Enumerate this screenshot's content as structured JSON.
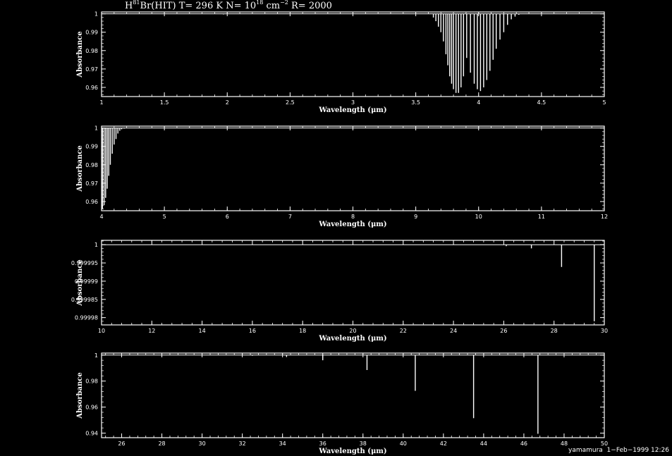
{
  "title": {
    "species_prefix": "H",
    "isotope": "81",
    "species_rest": "Br(HIT) T= 296 K N= 10",
    "exponent_n": "18",
    "unit": " cm",
    "exponent_unit": "−2",
    "resolution": " R= 2000"
  },
  "footer": "yamamura  1−Feb−1999 12:26",
  "chart_data": [
    {
      "type": "line",
      "xlabel": "Wavelength (μm)",
      "ylabel": "Absorbance",
      "xlim": [
        1,
        5
      ],
      "ylim": [
        0.955,
        1.001
      ],
      "xticks": [
        1,
        1.5,
        2,
        2.5,
        3,
        3.5,
        4,
        4.5,
        5
      ],
      "xtick_labels": [
        "1",
        "1.5",
        "2",
        "2.5",
        "3",
        "3.5",
        "4",
        "4.5",
        "5"
      ],
      "yticks": [
        0.96,
        0.97,
        0.98,
        0.99,
        1
      ],
      "ytick_labels": [
        "0.96",
        "0.97",
        "0.98",
        "0.99",
        "1"
      ],
      "lines": [
        {
          "x": 1.97,
          "y": 0.9997
        },
        {
          "x": 3.64,
          "y": 0.998
        },
        {
          "x": 3.66,
          "y": 0.996
        },
        {
          "x": 3.68,
          "y": 0.993
        },
        {
          "x": 3.7,
          "y": 0.99
        },
        {
          "x": 3.72,
          "y": 0.985
        },
        {
          "x": 3.74,
          "y": 0.978
        },
        {
          "x": 3.755,
          "y": 0.972
        },
        {
          "x": 3.77,
          "y": 0.966
        },
        {
          "x": 3.785,
          "y": 0.962
        },
        {
          "x": 3.8,
          "y": 0.959
        },
        {
          "x": 3.82,
          "y": 0.957
        },
        {
          "x": 3.84,
          "y": 0.957
        },
        {
          "x": 3.86,
          "y": 0.96
        },
        {
          "x": 3.88,
          "y": 0.966
        },
        {
          "x": 3.905,
          "y": 0.976
        },
        {
          "x": 3.935,
          "y": 0.968
        },
        {
          "x": 3.965,
          "y": 0.962
        },
        {
          "x": 3.99,
          "y": 0.959
        },
        {
          "x": 4.015,
          "y": 0.958
        },
        {
          "x": 4.04,
          "y": 0.96
        },
        {
          "x": 4.065,
          "y": 0.964
        },
        {
          "x": 4.09,
          "y": 0.969
        },
        {
          "x": 4.115,
          "y": 0.975
        },
        {
          "x": 4.14,
          "y": 0.981
        },
        {
          "x": 4.17,
          "y": 0.986
        },
        {
          "x": 4.2,
          "y": 0.99
        },
        {
          "x": 4.23,
          "y": 0.994
        },
        {
          "x": 4.26,
          "y": 0.997
        },
        {
          "x": 4.29,
          "y": 0.9985
        },
        {
          "x": 4.32,
          "y": 0.9995
        }
      ]
    },
    {
      "type": "line",
      "xlabel": "Wavelength (μm)",
      "ylabel": "Absorbance",
      "xlim": [
        4,
        12
      ],
      "ylim": [
        0.955,
        1.001
      ],
      "xticks": [
        4,
        5,
        6,
        7,
        8,
        9,
        10,
        11,
        12
      ],
      "xtick_labels": [
        "4",
        "5",
        "6",
        "7",
        "8",
        "9",
        "10",
        "11",
        "12"
      ],
      "yticks": [
        0.96,
        0.97,
        0.98,
        0.99,
        1
      ],
      "ytick_labels": [
        "0.96",
        "0.97",
        "0.98",
        "0.99",
        "1"
      ],
      "lines": [
        {
          "x": 4.015,
          "y": 0.956
        },
        {
          "x": 4.04,
          "y": 0.958
        },
        {
          "x": 4.065,
          "y": 0.962
        },
        {
          "x": 4.09,
          "y": 0.967
        },
        {
          "x": 4.115,
          "y": 0.974
        },
        {
          "x": 4.14,
          "y": 0.98
        },
        {
          "x": 4.17,
          "y": 0.986
        },
        {
          "x": 4.2,
          "y": 0.991
        },
        {
          "x": 4.23,
          "y": 0.994
        },
        {
          "x": 4.26,
          "y": 0.997
        },
        {
          "x": 4.29,
          "y": 0.9985
        },
        {
          "x": 4.32,
          "y": 0.9993
        },
        {
          "x": 4.36,
          "y": 0.9997
        },
        {
          "x": 4.4,
          "y": 0.9999
        }
      ]
    },
    {
      "type": "line",
      "xlabel": "Wavelength (μm)",
      "ylabel": "Absorbance",
      "xlim": [
        10,
        30
      ],
      "ylim": [
        0.999978,
        1.0000012
      ],
      "xticks": [
        10,
        12,
        14,
        16,
        18,
        20,
        22,
        24,
        26,
        28,
        30
      ],
      "xtick_labels": [
        "10",
        "12",
        "14",
        "16",
        "18",
        "20",
        "22",
        "24",
        "26",
        "28",
        "30"
      ],
      "yticks": [
        0.99998,
        0.999985,
        0.99999,
        0.999995,
        1
      ],
      "ytick_labels": [
        "0.99998",
        "0.999985",
        "0.99999",
        "0.999995",
        "1"
      ],
      "lines": [
        {
          "x": 26.1,
          "y": 0.9999996
        },
        {
          "x": 27.1,
          "y": 0.999999
        },
        {
          "x": 28.3,
          "y": 0.9999939
        },
        {
          "x": 29.6,
          "y": 0.999979
        }
      ]
    },
    {
      "type": "line",
      "xlabel": "Wavelength (μm)",
      "ylabel": "Absorbance",
      "xlim": [
        25,
        50
      ],
      "ylim": [
        0.9365,
        1.0015
      ],
      "xticks": [
        26,
        28,
        30,
        32,
        34,
        36,
        38,
        40,
        42,
        44,
        46,
        48,
        50
      ],
      "xtick_labels": [
        "26",
        "28",
        "30",
        "32",
        "34",
        "36",
        "38",
        "40",
        "42",
        "44",
        "46",
        "48",
        "50"
      ],
      "yticks": [
        0.94,
        0.96,
        0.98,
        1
      ],
      "ytick_labels": [
        "0.94",
        "0.96",
        "0.98",
        "1"
      ],
      "lines": [
        {
          "x": 32.5,
          "y": 0.9995
        },
        {
          "x": 34.2,
          "y": 0.9985
        },
        {
          "x": 36.0,
          "y": 0.996
        },
        {
          "x": 38.2,
          "y": 0.9885
        },
        {
          "x": 40.6,
          "y": 0.9725
        },
        {
          "x": 43.5,
          "y": 0.9515
        },
        {
          "x": 46.7,
          "y": 0.9395
        }
      ]
    }
  ]
}
